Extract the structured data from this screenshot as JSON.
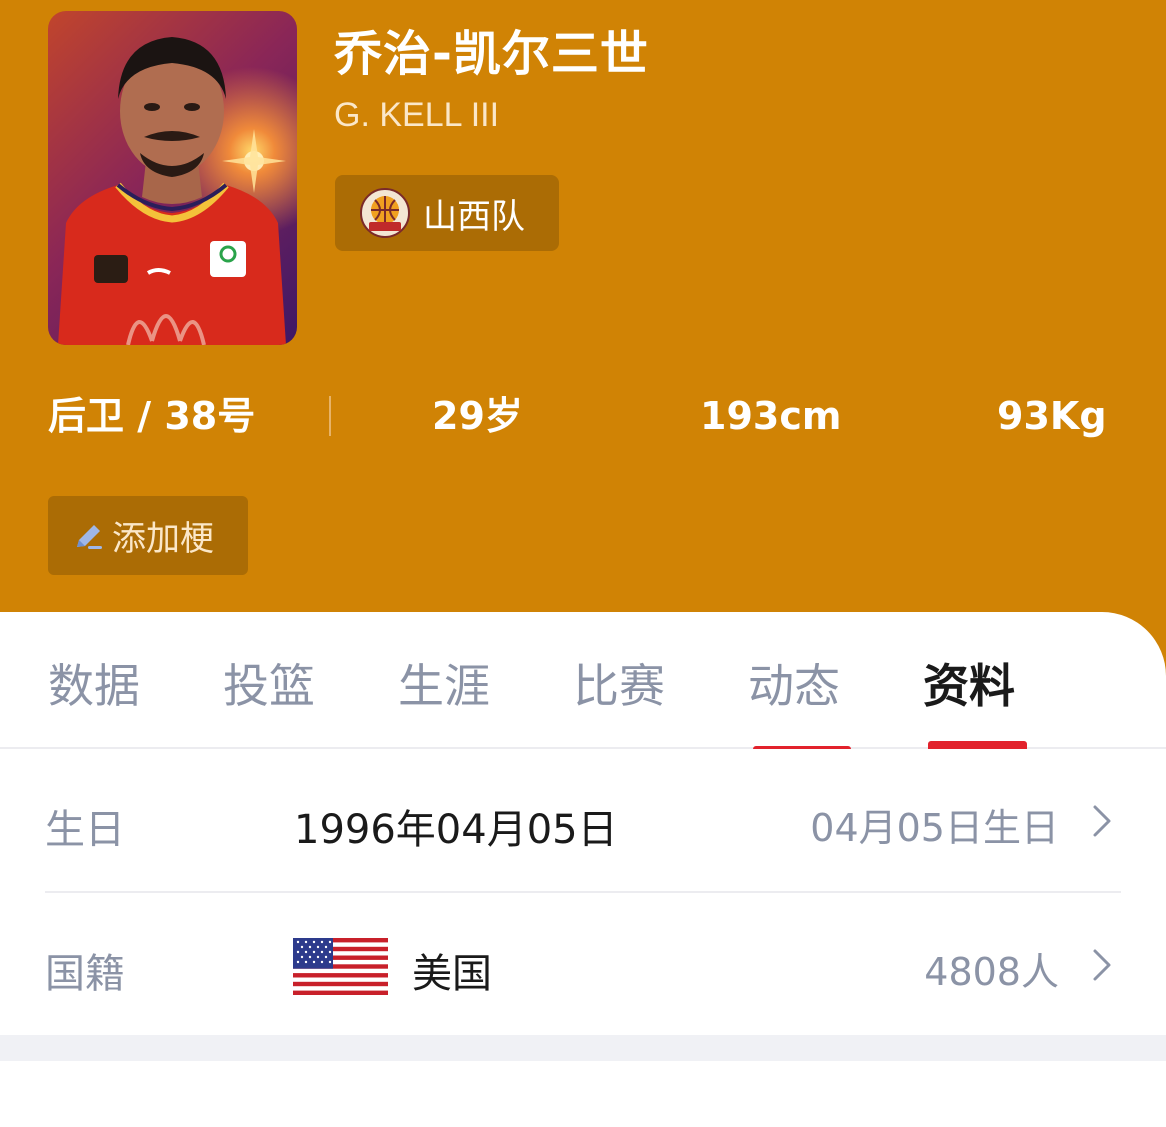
{
  "player": {
    "name_cn": "乔治-凯尔三世",
    "name_en": "G. KELL III",
    "team": "山西队"
  },
  "stats": {
    "position_number": "后卫 / 38号",
    "age": "29岁",
    "height": "193cm",
    "weight": "93Kg"
  },
  "actions": {
    "add_tag": "添加梗"
  },
  "tabs": [
    {
      "label": "数据"
    },
    {
      "label": "投篮"
    },
    {
      "label": "生涯"
    },
    {
      "label": "比赛"
    },
    {
      "label": "动态"
    },
    {
      "label": "资料"
    }
  ],
  "active_tab": "资料",
  "profile": {
    "birthday": {
      "label": "生日",
      "value": "1996年04月05日",
      "extra": "04月05日生日"
    },
    "nationality": {
      "label": "国籍",
      "value": "美国",
      "extra": "4808人",
      "flag_icon": "us-flag-icon"
    }
  },
  "colors": {
    "header_bg": "#d08305",
    "chip_bg": "#ab6c05",
    "tab_indicator": "#e2222c",
    "muted_text": "#8b93a6"
  }
}
